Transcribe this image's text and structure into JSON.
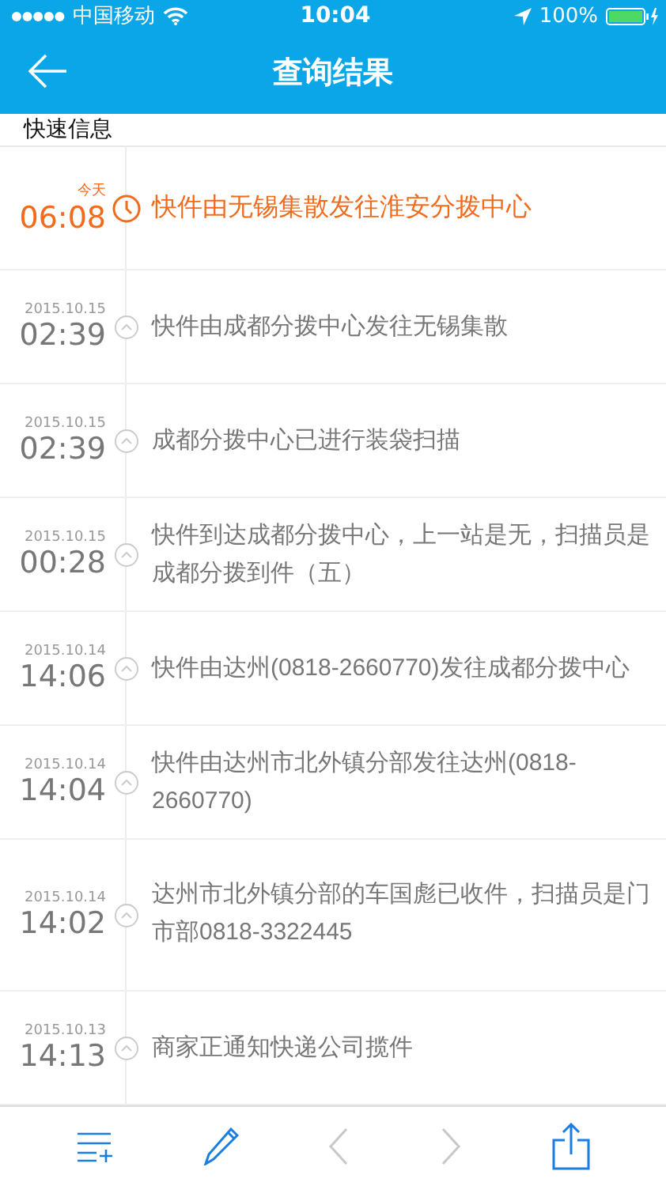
{
  "status_bar": {
    "carrier": "中国移动",
    "time": "10:04",
    "battery": "100%"
  },
  "nav": {
    "title": "查询结果"
  },
  "section": {
    "title": "快速信息"
  },
  "events": [
    {
      "kind": "current",
      "date": "今天",
      "time": "06:08",
      "text": "快件由无锡集散发往淮安分拨中心",
      "tall": false
    },
    {
      "kind": "past",
      "date": "2015.10.15",
      "time": "02:39",
      "text": "快件由成都分拨中心发往无锡集散",
      "tall": false
    },
    {
      "kind": "past",
      "date": "2015.10.15",
      "time": "02:39",
      "text": "成都分拨中心已进行装袋扫描",
      "tall": false
    },
    {
      "kind": "past",
      "date": "2015.10.15",
      "time": "00:28",
      "text": "快件到达成都分拨中心，上一站是无，扫描员是成都分拨到件（五）",
      "tall": false
    },
    {
      "kind": "past",
      "date": "2015.10.14",
      "time": "14:06",
      "text": "快件由达州(0818-2660770)发往成都分拨中心",
      "tall": false
    },
    {
      "kind": "past",
      "date": "2015.10.14",
      "time": "14:04",
      "text": "快件由达州市北外镇分部发往达州(0818-2660770)",
      "tall": false
    },
    {
      "kind": "past",
      "date": "2015.10.14",
      "time": "14:02",
      "text": "达州市北外镇分部的车国彪已收件，扫描员是门市部0818-3322445",
      "tall": true
    },
    {
      "kind": "past",
      "date": "2015.10.13",
      "time": "14:13",
      "text": "商家正通知快递公司揽件",
      "tall": false
    }
  ],
  "toolbar": [
    {
      "kind": "list-add",
      "disabled": false
    },
    {
      "kind": "pencil",
      "disabled": false
    },
    {
      "kind": "prev",
      "disabled": true
    },
    {
      "kind": "next",
      "disabled": true
    },
    {
      "kind": "share",
      "disabled": false
    }
  ]
}
